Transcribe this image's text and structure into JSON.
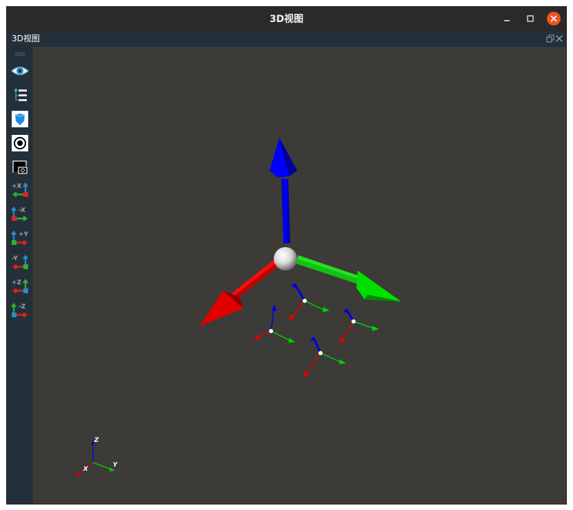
{
  "window": {
    "title": "3D视图"
  },
  "dock": {
    "title": "3D视图"
  },
  "toolbar": {
    "buttons": [
      {
        "name": "view-eye-icon"
      },
      {
        "name": "tree-list-icon"
      },
      {
        "name": "shield-box-icon"
      },
      {
        "name": "target-icon"
      },
      {
        "name": "screenshot-camera-icon"
      },
      {
        "name": "view-plus-x-icon",
        "label": "+X"
      },
      {
        "name": "view-minus-x-icon",
        "label": "-X"
      },
      {
        "name": "view-plus-y-icon",
        "label": "+Y"
      },
      {
        "name": "view-minus-y-icon",
        "label": "-Y"
      },
      {
        "name": "view-plus-z-icon",
        "label": "+Z"
      },
      {
        "name": "view-minus-z-icon",
        "label": "-Z"
      }
    ]
  },
  "scene": {
    "axis_colors": {
      "x": "#e00000",
      "y": "#00d400",
      "z": "#0000e0"
    },
    "mini_axes": {
      "x_label": "X",
      "y_label": "Y",
      "z_label": "Z"
    }
  },
  "colors": {
    "title_bar": "#2c2a28",
    "panel": "#23303a",
    "viewport": "#3d3b37",
    "close_button": "#e95420"
  }
}
